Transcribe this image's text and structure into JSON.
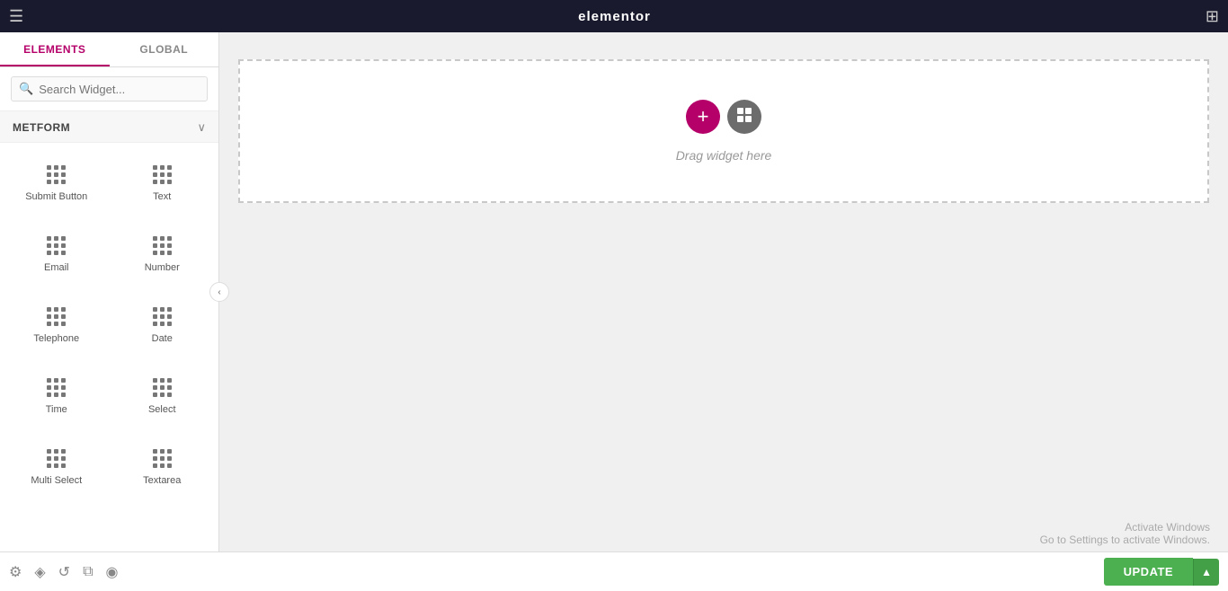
{
  "topbar": {
    "logo": "elementor",
    "menu_icon": "☰",
    "grid_icon": "⊞"
  },
  "sidebar": {
    "tabs": [
      {
        "id": "elements",
        "label": "ELEMENTS",
        "active": true
      },
      {
        "id": "global",
        "label": "GLOBAL",
        "active": false
      }
    ],
    "search": {
      "placeholder": "Search Widget...",
      "value": ""
    },
    "section": {
      "title": "METFORM",
      "collapsed": false
    },
    "widgets": [
      {
        "id": "submit-button",
        "label": "Submit Button"
      },
      {
        "id": "text",
        "label": "Text"
      },
      {
        "id": "email",
        "label": "Email"
      },
      {
        "id": "number",
        "label": "Number"
      },
      {
        "id": "telephone",
        "label": "Telephone"
      },
      {
        "id": "date",
        "label": "Date"
      },
      {
        "id": "time",
        "label": "Time"
      },
      {
        "id": "select",
        "label": "Select"
      },
      {
        "id": "multi-select",
        "label": "Multi Select"
      },
      {
        "id": "textarea",
        "label": "Textarea"
      }
    ]
  },
  "canvas": {
    "drag_text": "Drag widget here",
    "add_btn_label": "+",
    "layout_btn_label": "▦"
  },
  "activate_windows": {
    "line1": "Activate Windows",
    "line2": "Go to Settings to activate Windows."
  },
  "bottom_toolbar": {
    "icons": [
      "⊙",
      "◈",
      "↺",
      "⧉",
      "◉"
    ],
    "update_label": "UPDATE",
    "arrow_label": "▲"
  }
}
